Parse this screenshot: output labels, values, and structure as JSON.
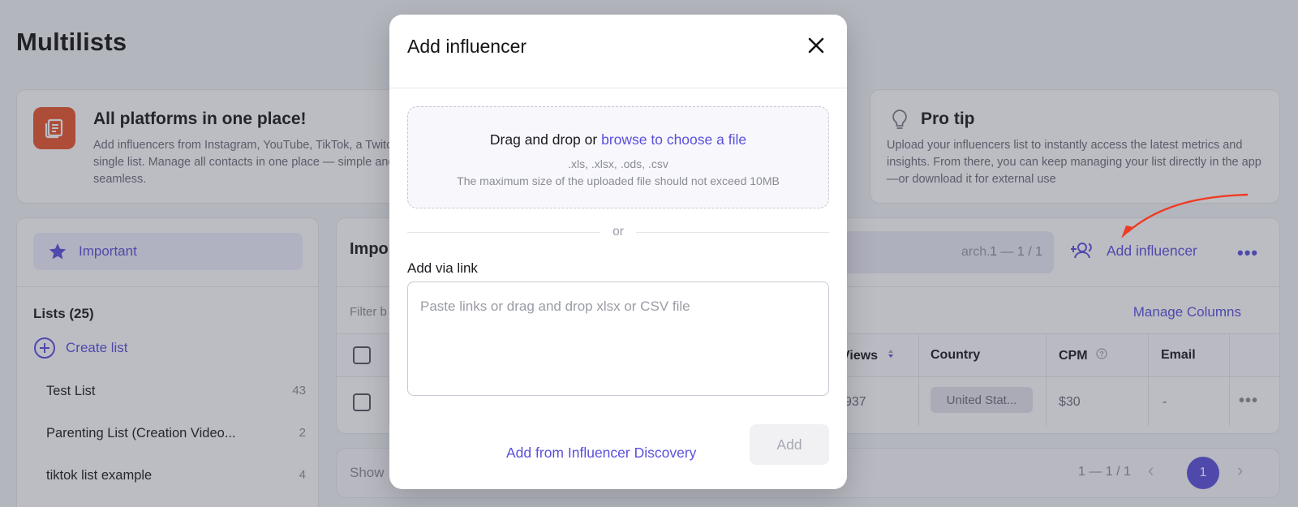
{
  "page": {
    "title": "Multilists"
  },
  "banners": {
    "left": {
      "title": "All platforms in one place!",
      "text": "Add influencers from Instagram, YouTube, TikTok, a Twitch into a single list. Manage all contacts in one place — simple and seamless.",
      "icon": "list-document-icon",
      "accent": "#e8552b"
    },
    "right": {
      "title": "Pro tip",
      "text": "Upload your influencers list to instantly access the latest metrics and insights. From there, you can keep managing your list directly in the app—or download it for external use",
      "icon": "lightbulb-icon"
    }
  },
  "sidebar": {
    "important_label": "Important",
    "lists_heading": "Lists (25)",
    "create_list_label": "Create list",
    "lists": [
      {
        "name": "Test List",
        "count": "43"
      },
      {
        "name": "Parenting List (Creation Video...",
        "count": "2"
      },
      {
        "name": "tiktok list example",
        "count": "4"
      }
    ]
  },
  "main": {
    "title": "Impo",
    "search_placeholder": "arch...",
    "search_count": "1 — 1 / 1",
    "add_influencer_label": "Add influencer",
    "more_label": "•••",
    "filter_label": "Filter b",
    "manage_columns_label": "Manage Columns",
    "columns": {
      "views": "Views",
      "country": "Country",
      "cpm": "CPM",
      "email": "Email"
    },
    "row": {
      "views": "937",
      "country": "United Stat...",
      "cpm": "$30",
      "email": "-"
    }
  },
  "footer": {
    "show_label": "Show",
    "count": "1 — 1 / 1",
    "current_page": "1"
  },
  "modal": {
    "title": "Add influencer",
    "dropzone_prefix": "Drag and drop or",
    "dropzone_link": "browse to choose a file",
    "file_types": ".xls, .xlsx, .ods, .csv",
    "size_limit": "The maximum size of the uploaded file should not exceed 10MB",
    "or_text": "or",
    "via_link_label": "Add via link",
    "link_placeholder": "Paste links or drag and drop xlsx or CSV file",
    "link_value": "",
    "discovery_link": "Add from Influencer Discovery",
    "add_button": "Add"
  },
  "colors": {
    "accent": "#5a50dd",
    "annotation_arrow": "#f03b24"
  }
}
